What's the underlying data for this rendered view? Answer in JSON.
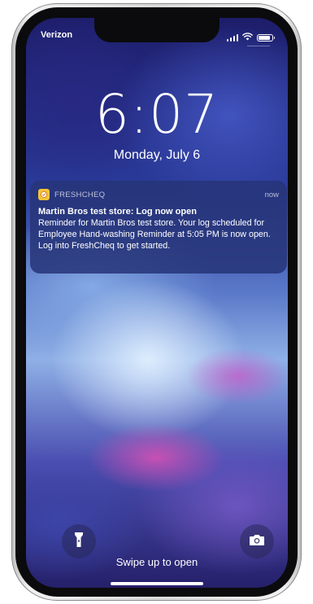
{
  "status_bar": {
    "carrier": "Verizon",
    "icons": [
      "signal-icon",
      "wifi-icon",
      "battery-icon"
    ],
    "battery_level": 0.9
  },
  "lock_screen": {
    "time": "6:07",
    "date": "Monday, July 6"
  },
  "notification": {
    "app_icon": "freshcheq-app-icon",
    "app_name": "FRESHCHEQ",
    "time": "now",
    "title": "Martin Bros test store: Log now open",
    "body": "Reminder for Martin Bros test store. Your log scheduled for Employee Hand-washing Reminder at 5:05 PM is now open. Log into FreshCheq to get started."
  },
  "bottom": {
    "flashlight_icon": "flashlight-icon",
    "camera_icon": "camera-icon",
    "swipe_text": "Swipe up to open"
  },
  "colors": {
    "accent_app_icon": "#f4c43a",
    "notification_bg": "#263478"
  }
}
